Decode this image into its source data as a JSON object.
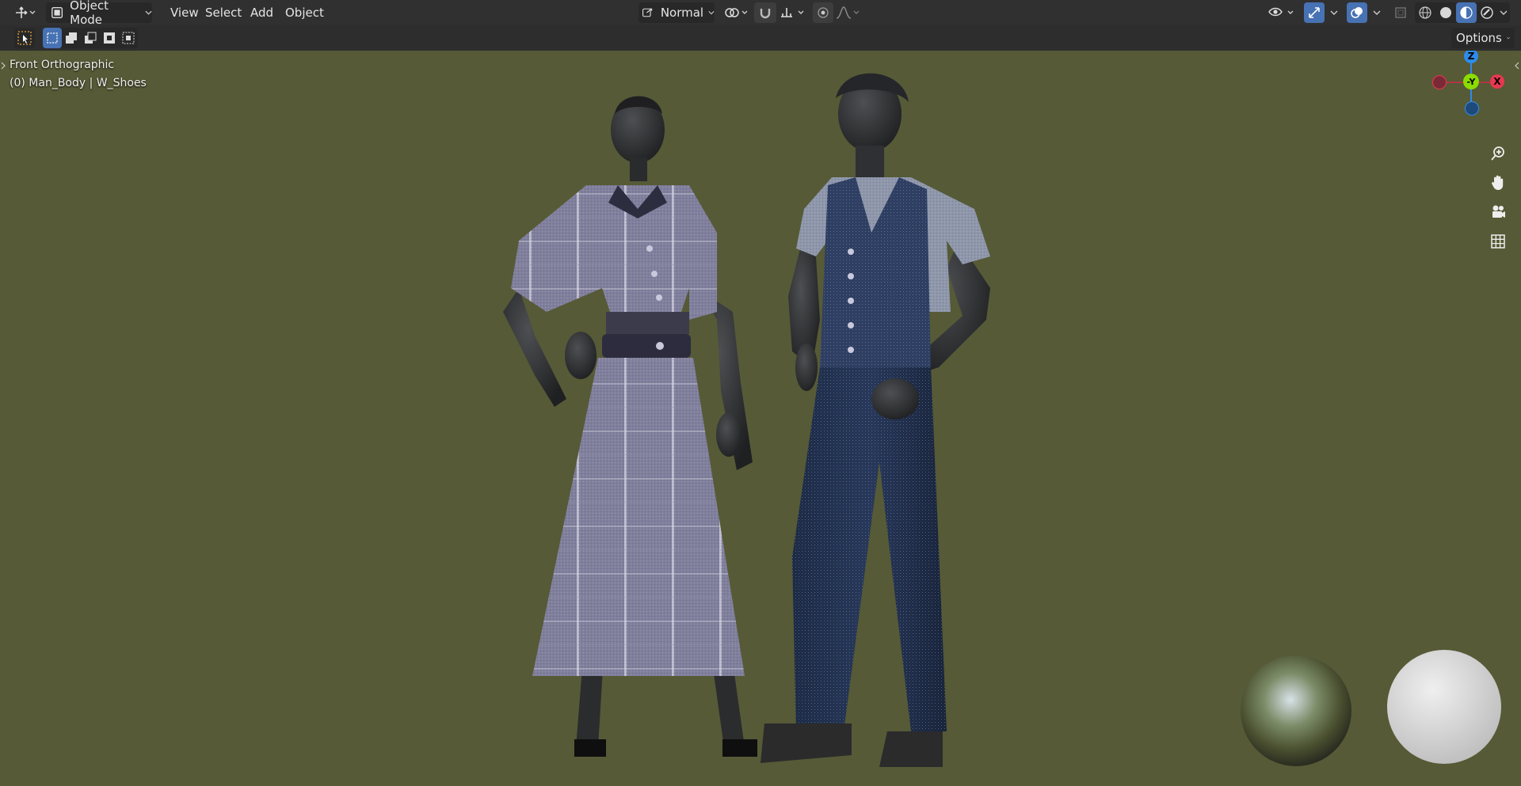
{
  "header": {
    "mode_label": "Object Mode",
    "menus": [
      "View",
      "Select",
      "Add",
      "Object"
    ],
    "orientation_label": "Normal"
  },
  "toolbar": {
    "options_label": "Options"
  },
  "viewport": {
    "view_name": "Front Orthographic",
    "selection_info": "(0) Man_Body | W_Shoes",
    "background_color": "#565a36"
  },
  "gizmo": {
    "z_label": "Z",
    "y_label": "-Y",
    "x_label": "X",
    "x_color": "#e8384f",
    "y_color": "#8bdc00",
    "z_color": "#2d8ceb"
  },
  "icons": {
    "editor_type": "transform-gizmo-icon",
    "mode": "object-mode-icon",
    "zoom": "zoom-in-icon",
    "pan": "hand-icon",
    "camera": "camera-icon",
    "ortho": "grid-icon"
  }
}
